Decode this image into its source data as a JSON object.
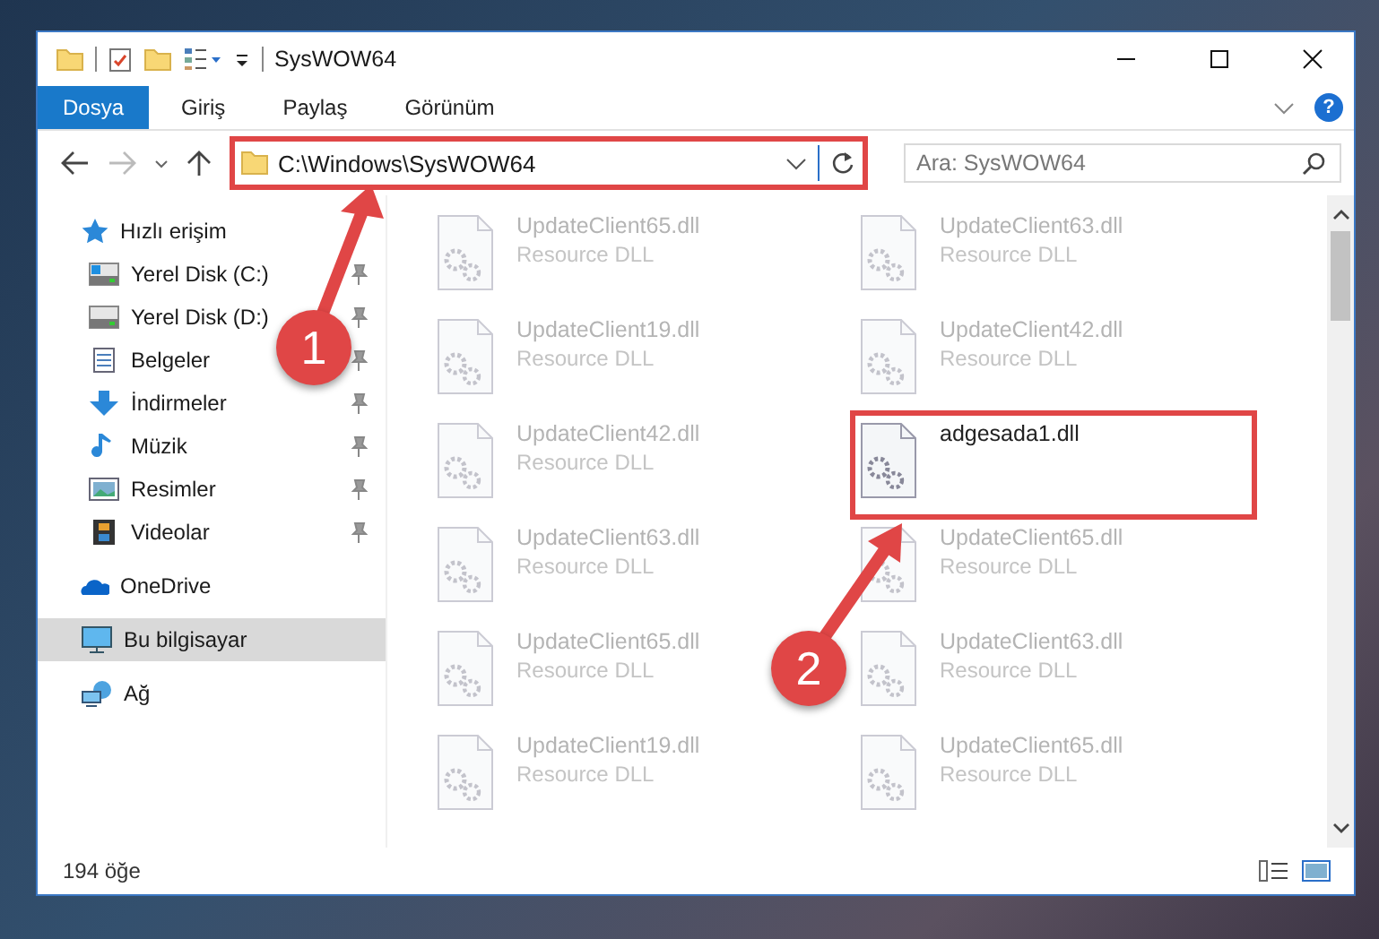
{
  "window": {
    "title": "SysWOW64"
  },
  "ribbon_tabs": [
    {
      "label": "Dosya",
      "selected": true
    },
    {
      "label": "Giriş",
      "selected": false
    },
    {
      "label": "Paylaş",
      "selected": false
    },
    {
      "label": "Görünüm",
      "selected": false
    }
  ],
  "help": "?",
  "address": {
    "value": "C:\\Windows\\SysWOW64",
    "highlighted": true
  },
  "search": {
    "placeholder": "Ara: SysWOW64"
  },
  "sidebar": {
    "items": [
      {
        "label": "Hızlı erişim",
        "selected": false,
        "children": [
          {
            "label": "Yerel Disk (C:)",
            "pinned": true
          },
          {
            "label": "Yerel Disk (D:)",
            "pinned": true
          },
          {
            "label": "Belgeler",
            "pinned": true
          },
          {
            "label": "İndirmeler",
            "pinned": true
          },
          {
            "label": "Müzik",
            "pinned": true
          },
          {
            "label": "Resimler",
            "pinned": true
          },
          {
            "label": "Videolar",
            "pinned": true
          }
        ]
      },
      {
        "label": "OneDrive",
        "selected": false
      },
      {
        "label": "Bu bilgisayar",
        "selected": true
      },
      {
        "label": "Ağ",
        "selected": false
      }
    ]
  },
  "files": [
    {
      "name": "UpdateClient65.dll",
      "type": "Resource DLL",
      "blurred": true,
      "highlighted": false
    },
    {
      "name": "UpdateClient63.dll",
      "type": "Resource DLL",
      "blurred": true,
      "highlighted": false
    },
    {
      "name": "UpdateClient19.dll",
      "type": "Resource DLL",
      "blurred": true,
      "highlighted": false
    },
    {
      "name": "UpdateClient42.dll",
      "type": "Resource DLL",
      "blurred": true,
      "highlighted": false
    },
    {
      "name": "UpdateClient42.dll",
      "type": "Resource DLL",
      "blurred": true,
      "highlighted": false
    },
    {
      "name": "adgesada1.dll",
      "blurred": false,
      "highlighted": true
    },
    {
      "name": "UpdateClient63.dll",
      "type": "Resource DLL",
      "blurred": true,
      "highlighted": false
    },
    {
      "name": "UpdateClient65.dll",
      "type": "Resource DLL",
      "blurred": true,
      "highlighted": false
    },
    {
      "name": "UpdateClient65.dll",
      "type": "Resource DLL",
      "blurred": true,
      "highlighted": false
    },
    {
      "name": "UpdateClient63.dll",
      "type": "Resource DLL",
      "blurred": true,
      "highlighted": false
    },
    {
      "name": "UpdateClient19.dll",
      "type": "Resource DLL",
      "blurred": true,
      "highlighted": false
    },
    {
      "name": "UpdateClient65.dll",
      "type": "Resource DLL",
      "blurred": true,
      "highlighted": false
    }
  ],
  "status_bar": {
    "count": "194 öğe"
  },
  "annotations": [
    {
      "number": "1"
    },
    {
      "number": "2"
    }
  ]
}
